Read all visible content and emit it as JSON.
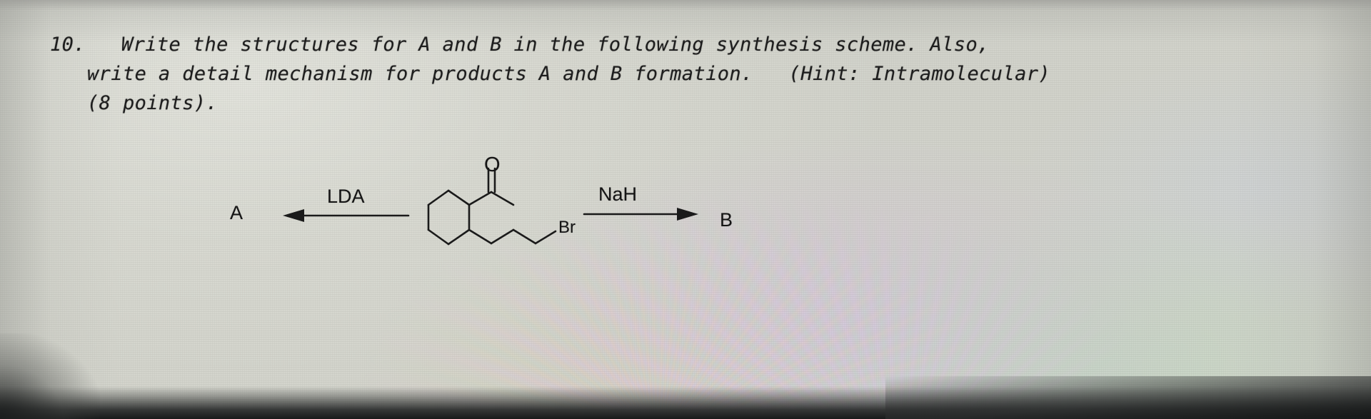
{
  "document": {
    "type": "exam-question-photo",
    "paper_color": "#d9dad2",
    "ink_color": "#1d1d1d"
  },
  "question": {
    "number": "10.",
    "line1": "10.   Write the structures for A and B in the following synthesis scheme. Also,",
    "line2": "write a detail mechanism for products A and B formation.   (Hint: Intramolecular)",
    "line3": "(8 points).",
    "points": "8 points",
    "hint": "Hint: Intramolecular"
  },
  "scheme": {
    "product_left_label": "A",
    "product_right_label": "B",
    "reagent_left": "LDA",
    "reagent_right": "NaH",
    "atom_labels": {
      "oxygen": "O",
      "bromine": "Br"
    },
    "left_arrow_direction": "left",
    "right_arrow_direction": "right",
    "structure_description": "cyclohexane ring with acetyl group and 3-bromopropyl chain on adjacent carbons"
  }
}
